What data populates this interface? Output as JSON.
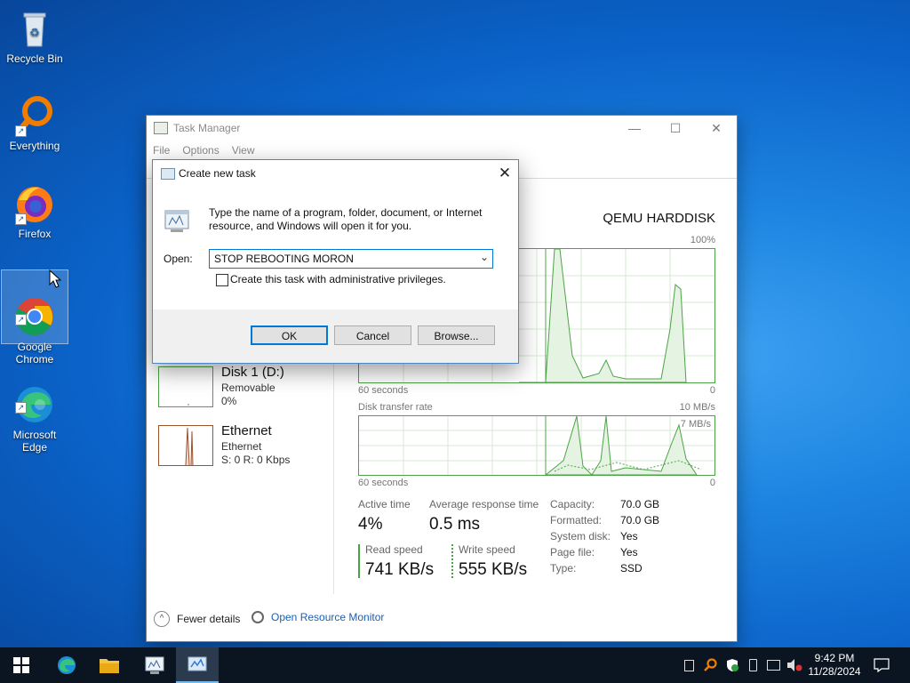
{
  "desktop": {
    "icons": [
      {
        "label": "Recycle Bin"
      },
      {
        "label": "Everything"
      },
      {
        "label": "Firefox"
      },
      {
        "label": "Google\nChrome"
      },
      {
        "label": "Microsoft\nEdge"
      }
    ]
  },
  "task_manager": {
    "title": "Task Manager",
    "menu": [
      "File",
      "Options",
      "View"
    ],
    "disk_model": "QEMU HARDDISK",
    "active_graph": {
      "max_label": "100%",
      "time_label": "60 seconds",
      "min_label": "0"
    },
    "transfer_graph": {
      "title": "Disk transfer rate",
      "max_label": "10 MB/s",
      "inner_label": "7 MB/s",
      "time_label": "60 seconds",
      "min_label": "0"
    },
    "side_items": [
      {
        "name": "Disk 1 (D:)",
        "sub1": "Removable",
        "sub2": "0%"
      },
      {
        "name": "Ethernet",
        "sub1": "Ethernet",
        "sub2": "S: 0  R: 0 Kbps"
      }
    ],
    "stats": {
      "active_time_label": "Active time",
      "active_time": "4%",
      "avg_resp_label": "Average response time",
      "avg_resp": "0.5 ms",
      "read_label": "Read speed",
      "read": "741 KB/s",
      "write_label": "Write speed",
      "write": "555 KB/s"
    },
    "props": [
      {
        "k": "Capacity:",
        "v": "70.0 GB"
      },
      {
        "k": "Formatted:",
        "v": "70.0 GB"
      },
      {
        "k": "System disk:",
        "v": "Yes"
      },
      {
        "k": "Page file:",
        "v": "Yes"
      },
      {
        "k": "Type:",
        "v": "SSD"
      }
    ],
    "footer": {
      "fewer": "Fewer details",
      "resmon": "Open Resource Monitor"
    }
  },
  "run_dialog": {
    "title": "Create new task",
    "description": "Type the name of a program, folder, document, or Internet resource, and Windows will open it for you.",
    "open_label": "Open:",
    "input_value": "STOP REBOOTING MORON",
    "checkbox_label": "Create this task with administrative privileges.",
    "ok": "OK",
    "cancel": "Cancel",
    "browse": "Browse..."
  },
  "taskbar": {
    "time": "9:42 PM",
    "date": "11/28/2024"
  },
  "colors": {
    "graph_green": "#4ca346",
    "ethernet_orange": "#a0522d",
    "accent": "#0078d7"
  }
}
